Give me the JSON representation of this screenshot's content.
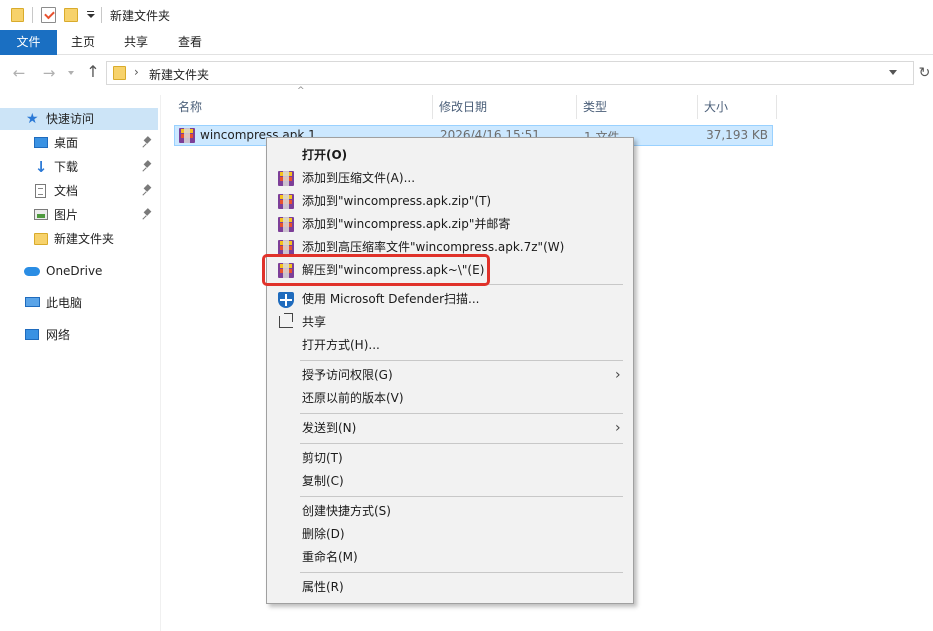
{
  "titlebar": {
    "title": "新建文件夹"
  },
  "ribbon": {
    "tabs": [
      "文件",
      "主页",
      "共享",
      "查看"
    ]
  },
  "address": {
    "path_segment": "新建文件夹"
  },
  "navpane": {
    "items": [
      {
        "label": "快速访问",
        "icon": "star-icon",
        "pinned": false
      },
      {
        "label": "桌面",
        "icon": "desktop-icon",
        "pinned": true
      },
      {
        "label": "下载",
        "icon": "download-icon",
        "pinned": true
      },
      {
        "label": "文档",
        "icon": "document-icon",
        "pinned": true
      },
      {
        "label": "图片",
        "icon": "pictures-icon",
        "pinned": true
      },
      {
        "label": "新建文件夹",
        "icon": "folder-icon",
        "pinned": false
      },
      {
        "label": "OneDrive",
        "icon": "cloud-icon",
        "pinned": false
      },
      {
        "label": "此电脑",
        "icon": "computer-icon",
        "pinned": false
      },
      {
        "label": "网络",
        "icon": "network-icon",
        "pinned": false
      }
    ]
  },
  "filelist": {
    "columns": [
      "名称",
      "修改日期",
      "类型",
      "大小"
    ],
    "rows": [
      {
        "name": "wincompress.apk.1",
        "date": "2026/4/16 15:51",
        "type": "1 文件",
        "size": "37,193 KB"
      }
    ]
  },
  "context_menu": {
    "items": [
      {
        "label": "打开(O)",
        "bold": true
      },
      {
        "label": "添加到压缩文件(A)...",
        "icon": "winrar-icon"
      },
      {
        "label": "添加到\"wincompress.apk.zip\"(T)",
        "icon": "winrar-icon"
      },
      {
        "label": "添加到\"wincompress.apk.zip\"并邮寄",
        "icon": "winrar-icon"
      },
      {
        "label": "添加到高压缩率文件\"wincompress.apk.7z\"(W)",
        "icon": "winrar-icon"
      },
      {
        "label": "解压到\"wincompress.apk~\\\"(E)",
        "icon": "winrar-icon",
        "highlighted": true
      },
      {
        "label": "使用 Microsoft Defender扫描...",
        "icon": "defender-shield-icon"
      },
      {
        "label": "共享",
        "icon": "share-icon"
      },
      {
        "label": "打开方式(H)..."
      },
      {
        "label": "授予访问权限(G)",
        "submenu": true
      },
      {
        "label": "还原以前的版本(V)"
      },
      {
        "label": "发送到(N)",
        "submenu": true
      },
      {
        "label": "剪切(T)"
      },
      {
        "label": "复制(C)"
      },
      {
        "label": "创建快捷方式(S)"
      },
      {
        "label": "删除(D)"
      },
      {
        "label": "重命名(M)"
      },
      {
        "label": "属性(R)"
      }
    ]
  },
  "colors": {
    "ribbon_file_tab": "#1a6fc2",
    "selection": "#cce8ff",
    "highlight_box": "#e0322a"
  }
}
